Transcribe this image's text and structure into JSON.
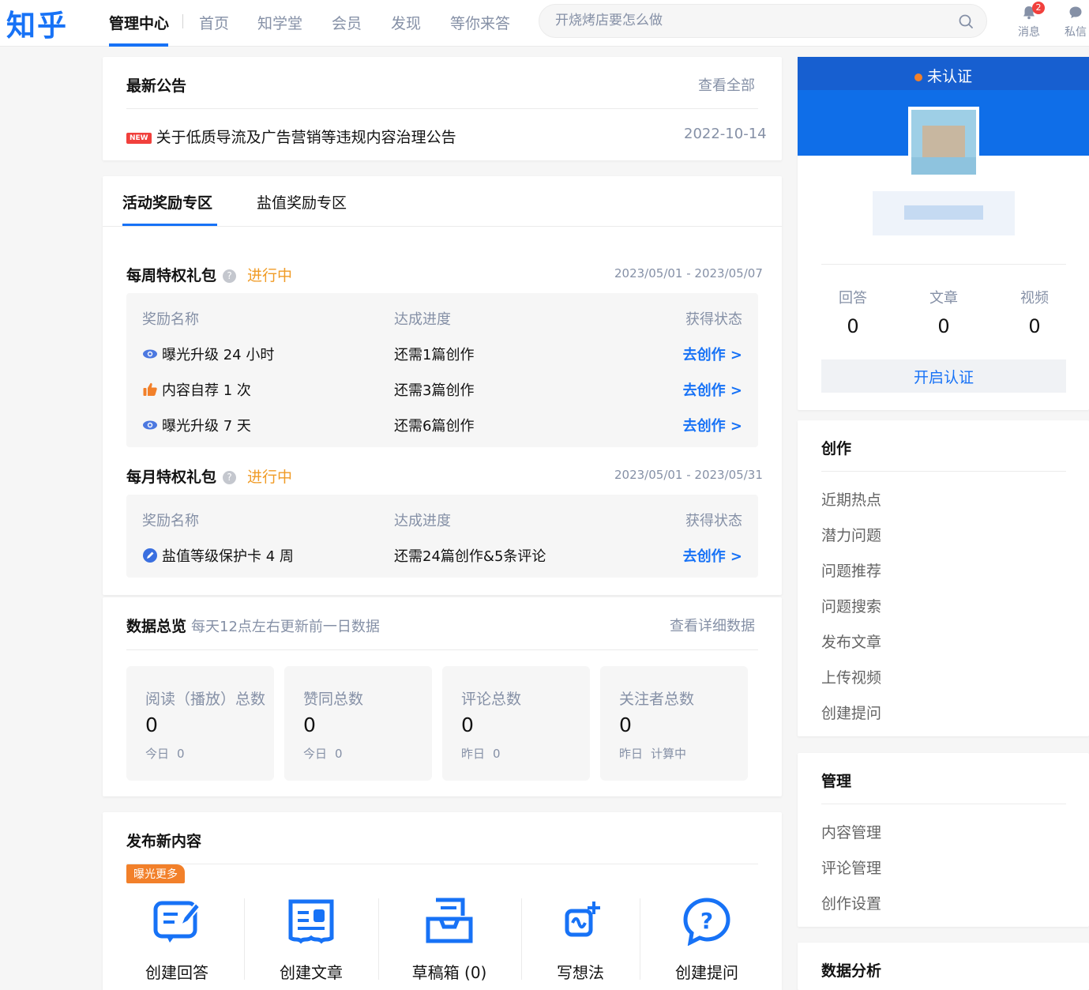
{
  "header": {
    "logo": "知乎",
    "nav": [
      "管理中心",
      "首页",
      "知学堂",
      "会员",
      "发现",
      "等你来答"
    ],
    "search_placeholder": "开烧烤店要怎么做",
    "messages_label": "消息",
    "messages_badge": "2",
    "dm_label": "私信"
  },
  "announcement": {
    "title": "最新公告",
    "view_all": "查看全部",
    "new_tag": "NEW",
    "item_text": "关于低质导流及广告营销等违规内容治理公告",
    "item_date": "2022-10-14"
  },
  "rewards": {
    "tabs": [
      "活动奖励专区",
      "盐值奖励专区"
    ],
    "weekly": {
      "title": "每周特权礼包",
      "help": "?",
      "status": "进行中",
      "date_range": "2023/05/01 - 2023/05/07",
      "headers": [
        "奖励名称",
        "达成进度",
        "获得状态"
      ],
      "rows": [
        {
          "icon": "eye-icon",
          "name": "曝光升级 24 小时",
          "progress": "还需1篇创作",
          "action": "去创作 >"
        },
        {
          "icon": "thumbs-up-icon",
          "name": "内容自荐 1 次",
          "progress": "还需3篇创作",
          "action": "去创作 >"
        },
        {
          "icon": "eye-icon",
          "name": "曝光升级 7 天",
          "progress": "还需6篇创作",
          "action": "去创作 >"
        }
      ]
    },
    "monthly": {
      "title": "每月特权礼包",
      "help": "?",
      "status": "进行中",
      "date_range": "2023/05/01 - 2023/05/31",
      "headers": [
        "奖励名称",
        "达成进度",
        "获得状态"
      ],
      "rows": [
        {
          "icon": "shield-pen-icon",
          "name": "盐值等级保护卡 4 周",
          "progress": "还需24篇创作&5条评论",
          "action": "去创作 >"
        }
      ]
    }
  },
  "overview": {
    "title": "数据总览",
    "subtitle": "每天12点左右更新前一日数据",
    "detail_link": "查看详细数据",
    "tiles": [
      {
        "label": "阅读（播放）总数",
        "value": "0",
        "sub_label": "今日",
        "sub_value": "0"
      },
      {
        "label": "赞同总数",
        "value": "0",
        "sub_label": "今日",
        "sub_value": "0"
      },
      {
        "label": "评论总数",
        "value": "0",
        "sub_label": "昨日",
        "sub_value": "0"
      },
      {
        "label": "关注者总数",
        "value": "0",
        "sub_label": "昨日",
        "sub_value": "计算中"
      }
    ]
  },
  "publish": {
    "title": "发布新内容",
    "tag": "曝光更多",
    "tools": [
      {
        "icon": "create-answer-icon",
        "label": "创建回答"
      },
      {
        "icon": "create-article-icon",
        "label": "创建文章"
      },
      {
        "icon": "drafts-icon",
        "label": "草稿箱 (0)"
      },
      {
        "icon": "write-idea-icon",
        "label": "写想法"
      },
      {
        "icon": "ask-question-icon",
        "label": "创建提问"
      }
    ]
  },
  "profile": {
    "status": "未认证",
    "stats": [
      {
        "label": "回答",
        "value": "0"
      },
      {
        "label": "文章",
        "value": "0"
      },
      {
        "label": "视频",
        "value": "0"
      }
    ],
    "cert_button": "开启认证"
  },
  "sidebar": {
    "create_title": "创作",
    "create_items": [
      "近期热点",
      "潜力问题",
      "问题推荐",
      "问题搜索",
      "发布文章",
      "上传视频",
      "创建提问"
    ],
    "manage_title": "管理",
    "manage_items": [
      "内容管理",
      "评论管理",
      "创作设置"
    ],
    "analysis_title": "数据分析"
  },
  "colors": {
    "brand": "#1772f6",
    "status_orange": "#f09b26",
    "new_red": "#f1403c"
  }
}
